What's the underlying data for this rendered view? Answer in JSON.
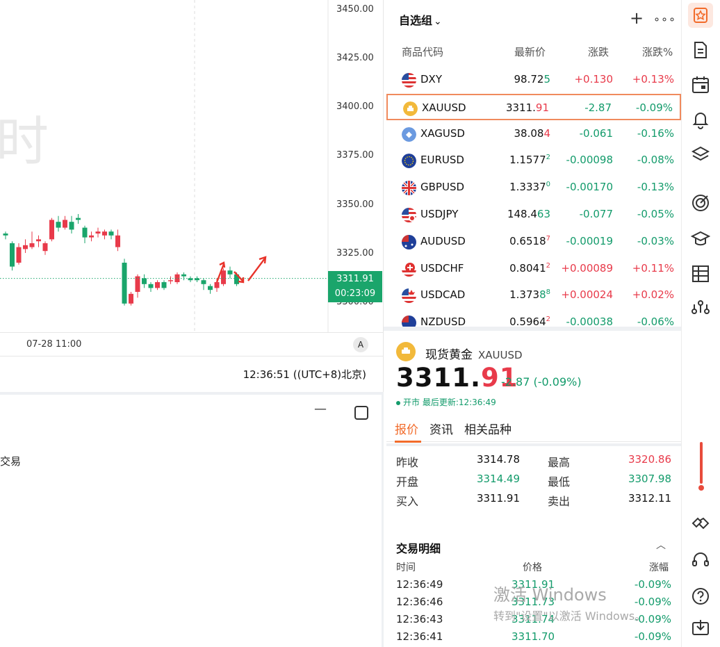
{
  "chart": {
    "watermark": "时",
    "y_axis": [
      "3450.00",
      "3425.00",
      "3400.00",
      "3375.00",
      "3350.00",
      "3325.00",
      "3300.00"
    ],
    "price_tag": {
      "price": "3311.91",
      "countdown": "00:23:09"
    },
    "x_label": "07-28 11:00",
    "auto_label": "A",
    "clock": "12:36:51 ((UTC+8)北京)",
    "bottom_partial_text": "交易",
    "colors": {
      "up": "#e83a4a",
      "down": "#1aa56b",
      "tag": "#1aa56b"
    }
  },
  "watchlist": {
    "title": "自选组",
    "columns": {
      "code": "商品代码",
      "price": "最新价",
      "change": "涨跌",
      "pct": "涨跌%"
    },
    "rows": [
      {
        "symbol": "DXY",
        "price_main": "98.72",
        "price_tail": "5",
        "price_sup": "",
        "change": "+0.130",
        "pct": "+0.13%",
        "dir": "up",
        "tail_dir": "down",
        "flag": "us"
      },
      {
        "symbol": "XAUUSD",
        "price_main": "3311.",
        "price_tail": "91",
        "price_sup": "",
        "change": "-2.87",
        "pct": "-0.09%",
        "dir": "down",
        "tail_dir": "up",
        "flag": "gold"
      },
      {
        "symbol": "XAGUSD",
        "price_main": "38.08",
        "price_tail": "4",
        "price_sup": "",
        "change": "-0.061",
        "pct": "-0.16%",
        "dir": "down",
        "tail_dir": "up",
        "flag": "silver"
      },
      {
        "symbol": "EURUSD",
        "price_main": "1.1577",
        "price_tail": "",
        "price_sup": "2",
        "change": "-0.00098",
        "pct": "-0.08%",
        "dir": "down",
        "tail_dir": "down",
        "flag": "eu"
      },
      {
        "symbol": "GBPUSD",
        "price_main": "1.3337",
        "price_tail": "",
        "price_sup": "0",
        "change": "-0.00170",
        "pct": "-0.13%",
        "dir": "down",
        "tail_dir": "down",
        "flag": "gb"
      },
      {
        "symbol": "USDJPY",
        "price_main": "148.4",
        "price_tail": "63",
        "price_sup": "",
        "change": "-0.077",
        "pct": "-0.05%",
        "dir": "down",
        "tail_dir": "down",
        "flag": "jp"
      },
      {
        "symbol": "AUDUSD",
        "price_main": "0.6518",
        "price_tail": "",
        "price_sup": "7",
        "change": "-0.00019",
        "pct": "-0.03%",
        "dir": "down",
        "tail_dir": "up",
        "flag": "au"
      },
      {
        "symbol": "USDCHF",
        "price_main": "0.8041",
        "price_tail": "",
        "price_sup": "2",
        "change": "+0.00089",
        "pct": "+0.11%",
        "dir": "up",
        "tail_dir": "up",
        "flag": "ch"
      },
      {
        "symbol": "USDCAD",
        "price_main": "1.373",
        "price_tail": "8",
        "price_sup": "8",
        "change": "+0.00024",
        "pct": "+0.02%",
        "dir": "up",
        "tail_dir": "down",
        "flag": "ca"
      },
      {
        "symbol": "NZDUSD",
        "price_main": "0.5964",
        "price_tail": "",
        "price_sup": "2",
        "change": "-0.00038",
        "pct": "-0.06%",
        "dir": "down",
        "tail_dir": "up",
        "flag": "nz"
      }
    ]
  },
  "detail": {
    "name": "现货黄金",
    "code": "XAUUSD",
    "price_main": "3311.",
    "price_tail": "91",
    "change": "-2.87 (-0.09%)",
    "status": "开市 最后更新:12:36:49",
    "tabs": [
      "报价",
      "资讯",
      "相关品种"
    ],
    "stats": [
      {
        "label": "昨收",
        "value": "3314.78",
        "color": "#111",
        "label2": "最高",
        "value2": "3320.86",
        "color2": "#e83a4a"
      },
      {
        "label": "开盘",
        "value": "3314.49",
        "color": "#139b6b",
        "label2": "最低",
        "value2": "3307.98",
        "color2": "#139b6b"
      },
      {
        "label": "买入",
        "value": "3311.91",
        "color": "#111",
        "label2": "卖出",
        "value2": "3312.11",
        "color2": "#111"
      }
    ],
    "trades_title": "交易明细",
    "trade_cols": {
      "time": "时间",
      "price": "价格",
      "change": "涨幅"
    },
    "trades": [
      {
        "time": "12:36:49",
        "price": "3311.91",
        "pct": "-0.09%"
      },
      {
        "time": "12:36:46",
        "price": "3311.73",
        "pct": "-0.09%"
      },
      {
        "time": "12:36:43",
        "price": "3311.74",
        "pct": "-0.09%"
      },
      {
        "time": "12:36:41",
        "price": "3311.70",
        "pct": "-0.09%"
      }
    ],
    "os_watermark": {
      "line1": "激活 Windows",
      "line2": "转到\"设置\"以激活 Windows。"
    }
  },
  "rail": {
    "icons": [
      "star-icon",
      "document-icon",
      "calendar-icon",
      "bell-icon",
      "layers-icon",
      "target-icon",
      "graduation-cap-icon",
      "table-icon",
      "network-icon",
      "thermometer-icon",
      "handshake-icon",
      "headset-icon",
      "help-icon",
      "download-icon"
    ]
  }
}
